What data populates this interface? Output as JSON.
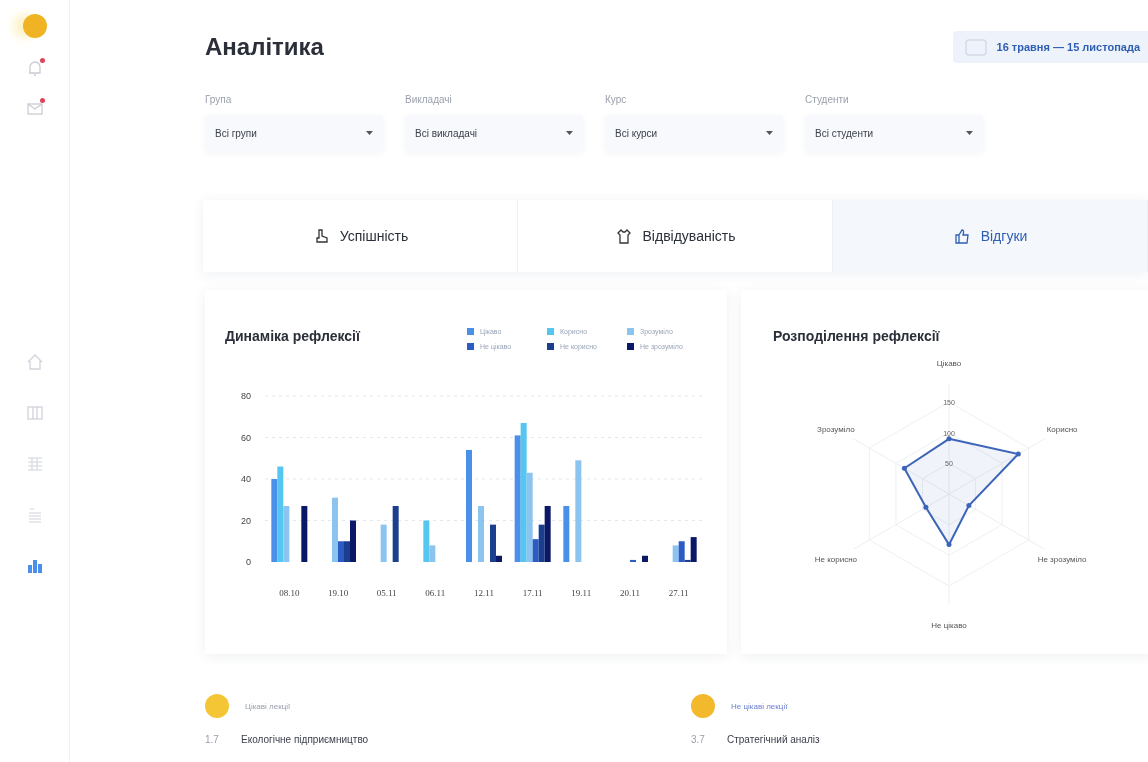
{
  "sidebar": {
    "items": [
      {
        "selected": false
      },
      {
        "selected": false
      },
      {
        "selected": false
      },
      {
        "selected": false
      },
      {
        "selected": true
      }
    ],
    "alerts": [
      {
        "unread": true
      },
      {
        "unread": true
      }
    ]
  },
  "header": {
    "title": "Аналітика",
    "date_range": "16 травня — 15 листопада"
  },
  "filters": [
    {
      "label": "Група",
      "value": "Всі групи"
    },
    {
      "label": "Викладачі",
      "value": "Всі викладачі"
    },
    {
      "label": "Курс",
      "value": "Всі курси"
    },
    {
      "label": "Студенти",
      "value": "Всі студенти"
    }
  ],
  "tabs": [
    {
      "label": "Успішність",
      "selected": false
    },
    {
      "label": "Відвідуваність",
      "selected": false
    },
    {
      "label": "Відгуки",
      "selected": true
    }
  ],
  "dynamics": {
    "title": "Динаміка рефлексії",
    "chart_data": {
      "type": "bar",
      "grid": true,
      "categories": [
        "08.10",
        "19.10",
        "05.11",
        "06.11",
        "12.11",
        "17.11",
        "19.11",
        "20.11",
        "27.11"
      ],
      "ylim": [
        0,
        80
      ],
      "yticks": [
        0,
        20,
        40,
        60,
        80
      ],
      "series": [
        {
          "name": "Цікаво",
          "color": "#4a8fe8",
          "values": [
            40,
            0,
            0,
            0,
            54,
            61,
            27,
            0,
            0
          ]
        },
        {
          "name": "Корисно",
          "color": "#55c6ef",
          "values": [
            46,
            0,
            0,
            20,
            0,
            67,
            0,
            0,
            0
          ]
        },
        {
          "name": "Зрозуміло",
          "color": "#8cc4f0",
          "values": [
            27,
            31,
            18,
            8,
            27,
            43,
            49,
            0,
            8
          ]
        },
        {
          "name": "Не цікаво",
          "color": "#2a5cc4",
          "values": [
            0,
            10,
            0,
            0,
            0,
            11,
            0,
            1,
            10
          ]
        },
        {
          "name": "Не корисно",
          "color": "#1b3f8c",
          "values": [
            0,
            10,
            27,
            0,
            18,
            18,
            0,
            0,
            1
          ]
        },
        {
          "name": "Не зрозуміло",
          "color": "#0b1767",
          "values": [
            27,
            20,
            0,
            0,
            3,
            27,
            0,
            3,
            12
          ]
        }
      ]
    }
  },
  "distribution": {
    "title": "Розподілення рефлексії",
    "ticks": [
      "150",
      "100",
      "50"
    ],
    "axes": [
      {
        "label": "Цікаво"
      },
      {
        "label": "Корисно"
      },
      {
        "label": "Не зрозуміло"
      },
      {
        "label": "Не цікаво"
      },
      {
        "label": "Не корисно"
      },
      {
        "label": "Зрозуміло"
      }
    ]
  },
  "lectures": [
    {
      "heading": "Цікаві лекції",
      "kind": "interesting",
      "rows": [
        {
          "score": "1.7",
          "name": "Екологічне підприємництво"
        }
      ]
    },
    {
      "heading": "Не цікаві лекції",
      "kind": "boring",
      "rows": [
        {
          "score": "3.7",
          "name": "Стратегічний аналіз"
        }
      ]
    }
  ]
}
